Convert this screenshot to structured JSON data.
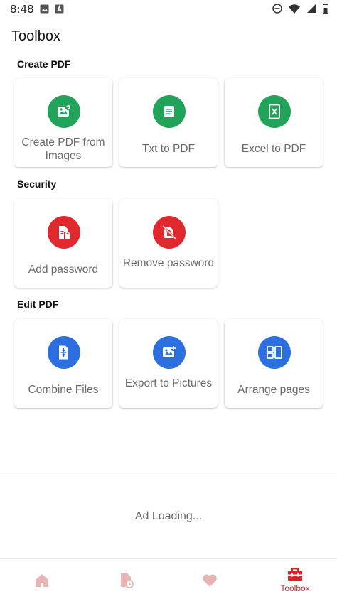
{
  "status": {
    "time": "8:48"
  },
  "page": {
    "title": "Toolbox"
  },
  "sections": [
    {
      "title": "Create PDF",
      "cards": [
        {
          "label": "Create PDF from Images",
          "icon": "image-add-icon",
          "color": "#22a35a"
        },
        {
          "label": "Txt to PDF",
          "icon": "text-file-icon",
          "color": "#22a35a"
        },
        {
          "label": "Excel to PDF",
          "icon": "excel-file-icon",
          "color": "#22a35a"
        }
      ]
    },
    {
      "title": "Security",
      "cards": [
        {
          "label": "Add password",
          "icon": "lock-file-icon",
          "color": "#e0282f"
        },
        {
          "label": "Remove password",
          "icon": "unlock-icon",
          "color": "#e0282f"
        }
      ]
    },
    {
      "title": "Edit PDF",
      "cards": [
        {
          "label": "Combine Files",
          "icon": "merge-file-icon",
          "color": "#2e6fe0"
        },
        {
          "label": "Export to Pictures",
          "icon": "image-export-icon",
          "color": "#2e6fe0"
        },
        {
          "label": "Arrange pages",
          "icon": "arrange-pages-icon",
          "color": "#2e6fe0"
        }
      ]
    }
  ],
  "ad": {
    "text": "Ad Loading..."
  },
  "nav": {
    "items": [
      {
        "icon": "home-icon",
        "label": ""
      },
      {
        "icon": "recent-files-icon",
        "label": ""
      },
      {
        "icon": "heart-icon",
        "label": ""
      },
      {
        "icon": "toolbox-icon",
        "label": "Toolbox",
        "active": true
      }
    ],
    "active_color": "#d4252d",
    "inactive_color": "#e8b4b4"
  }
}
